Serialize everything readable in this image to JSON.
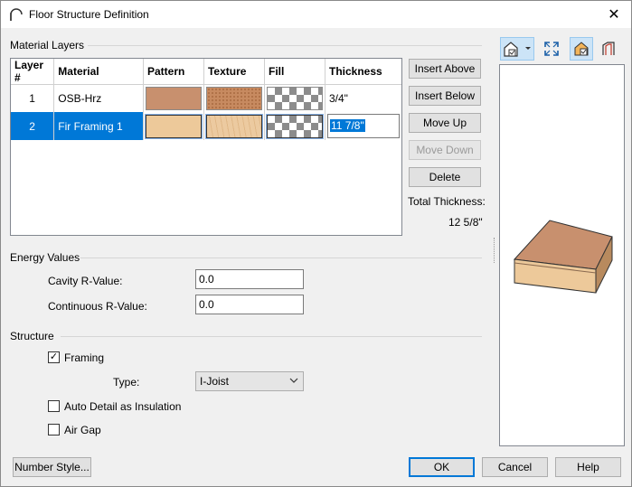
{
  "window": {
    "title": "Floor Structure Definition",
    "close": "✕"
  },
  "material_layers": {
    "label": "Material Layers",
    "columns": [
      "Layer #",
      "Material",
      "Pattern",
      "Texture",
      "Fill",
      "Thickness"
    ],
    "rows": [
      {
        "num": "1",
        "material": "OSB-Hrz",
        "thickness": "3/4\"",
        "pattern_color": "#c8906e",
        "texture_color": "#c78a60"
      },
      {
        "num": "2",
        "material": "Fir Framing 1",
        "thickness": "11 7/8\"",
        "pattern_color": "#edc99a",
        "texture_color": "#eccaa0"
      }
    ],
    "selected_row": 2
  },
  "layer_buttons": {
    "insert_above": "Insert Above",
    "insert_below": "Insert Below",
    "move_up": "Move Up",
    "move_down": "Move Down",
    "delete": "Delete"
  },
  "total_thickness": {
    "label": "Total Thickness:",
    "value": "12 5/8\""
  },
  "energy": {
    "label": "Energy Values",
    "cavity_label": "Cavity R-Value:",
    "cavity_value": "0.0",
    "continuous_label": "Continuous R-Value:",
    "continuous_value": "0.0"
  },
  "structure": {
    "label": "Structure",
    "framing_label": "Framing",
    "framing_checked": true,
    "type_label": "Type:",
    "type_value": "I-Joist",
    "auto_detail_label": "Auto Detail as Insulation",
    "auto_detail_checked": false,
    "air_gap_label": "Air Gap",
    "air_gap_checked": false
  },
  "footer": {
    "number_style": "Number Style...",
    "ok": "OK",
    "cancel": "Cancel",
    "help": "Help"
  },
  "icons": {
    "view": "view-mode-icon",
    "dropdown": "chevron-down-icon",
    "fill": "fill-window-icon",
    "color": "color-toggle-icon",
    "section": "section-view-icon"
  },
  "colors": {
    "accent": "#0078d7",
    "top_face": "#c8906e",
    "front_face": "#edc99a"
  }
}
